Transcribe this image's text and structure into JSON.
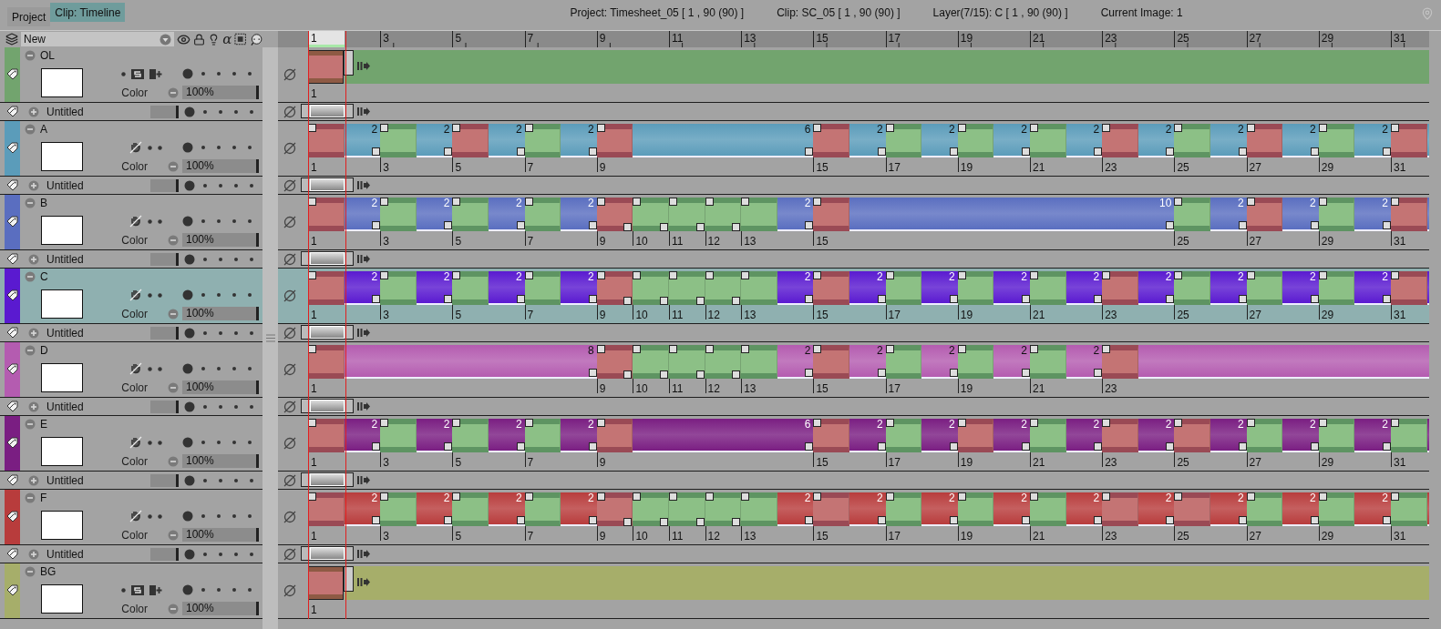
{
  "tabs": [
    {
      "label": "Project",
      "selected": false
    },
    {
      "label": "Clip: Timeline",
      "selected": true
    }
  ],
  "info": [
    "Project: Timesheet_05 [ 1 , 90  (90) ]",
    "Clip: SC_05 [ 1 , 90  (90) ]",
    "Layer(7/15): C [ 1 , 90  (90) ]",
    "Current Image: 1"
  ],
  "header": {
    "new_layer": "New",
    "alpha": "α"
  },
  "ruler": [
    {
      "label": "1",
      "selected": true
    },
    {
      "label": "3",
      "selected": false
    },
    {
      "label": "5",
      "selected": false
    },
    {
      "label": "7",
      "selected": false
    },
    {
      "label": "9",
      "selected": false
    },
    {
      "label": "11",
      "selected": false
    },
    {
      "label": "13",
      "selected": false
    },
    {
      "label": "15",
      "selected": false
    },
    {
      "label": "17",
      "selected": false
    },
    {
      "label": "19",
      "selected": false
    },
    {
      "label": "21",
      "selected": false
    },
    {
      "label": "23",
      "selected": false
    },
    {
      "label": "25",
      "selected": false
    },
    {
      "label": "27",
      "selected": false
    },
    {
      "label": "29",
      "selected": false
    },
    {
      "label": "31",
      "selected": false
    }
  ],
  "layers": [
    {
      "kind": "still",
      "name": "OL",
      "color": "#72a46e",
      "selected": false,
      "color_label": "Color",
      "opacity": "100%",
      "exposures": [
        {
          "frame": "1",
          "kind": "key",
          "open": true
        }
      ]
    },
    {
      "kind": "empty",
      "name": "Untitled",
      "level": 1
    },
    {
      "kind": "animation",
      "name": "A",
      "color": "#5b9cba",
      "selected": false,
      "color_label": "Color",
      "opacity": "100%",
      "exposures": [
        {
          "frame": "1",
          "kind": "key",
          "hold": "2"
        },
        {
          "frame": "3",
          "kind": "inbetween",
          "hold": "2"
        },
        {
          "frame": "5",
          "kind": "key",
          "hold": "2"
        },
        {
          "frame": "7",
          "kind": "inbetween",
          "hold": "2"
        },
        {
          "frame": "9",
          "kind": "key",
          "hold": "6"
        },
        {
          "frame": "15",
          "kind": "key",
          "hold": "2"
        },
        {
          "frame": "17",
          "kind": "inbetween",
          "hold": "2"
        },
        {
          "frame": "19",
          "kind": "inbetween",
          "hold": "2"
        },
        {
          "frame": "21",
          "kind": "inbetween",
          "hold": "2"
        },
        {
          "frame": "23",
          "kind": "key",
          "hold": "2"
        },
        {
          "frame": "25",
          "kind": "inbetween",
          "hold": "2"
        },
        {
          "frame": "27",
          "kind": "key",
          "hold": "2"
        },
        {
          "frame": "29",
          "kind": "inbetween",
          "hold": "2"
        },
        {
          "frame": "31",
          "kind": "key",
          "open": true
        }
      ]
    },
    {
      "kind": "empty",
      "name": "Untitled",
      "level": 1
    },
    {
      "kind": "animation",
      "name": "B",
      "color": "#5a6ec0",
      "selected": false,
      "color_label": "Color",
      "opacity": "100%",
      "exposures": [
        {
          "frame": "1",
          "kind": "key",
          "hold": "2"
        },
        {
          "frame": "3",
          "kind": "inbetween",
          "hold": "2"
        },
        {
          "frame": "5",
          "kind": "inbetween",
          "hold": "2"
        },
        {
          "frame": "7",
          "kind": "inbetween",
          "hold": "2"
        },
        {
          "frame": "9",
          "kind": "key"
        },
        {
          "frame": "10",
          "kind": "inbetween"
        },
        {
          "frame": "11",
          "kind": "inbetween"
        },
        {
          "frame": "12",
          "kind": "inbetween"
        },
        {
          "frame": "13",
          "kind": "inbetween",
          "hold": "2"
        },
        {
          "frame": "15",
          "kind": "key",
          "hold": "10"
        },
        {
          "frame": "25",
          "kind": "inbetween",
          "hold": "2"
        },
        {
          "frame": "27",
          "kind": "key",
          "hold": "2"
        },
        {
          "frame": "29",
          "kind": "inbetween",
          "hold": "2"
        },
        {
          "frame": "31",
          "kind": "key",
          "open": true
        }
      ]
    },
    {
      "kind": "empty",
      "name": "Untitled",
      "level": 1
    },
    {
      "kind": "animation",
      "name": "C",
      "color": "#5a1ad0",
      "selected": true,
      "color_label": "Color",
      "opacity": "100%",
      "exposures": [
        {
          "frame": "1",
          "kind": "key",
          "hold": "2"
        },
        {
          "frame": "3",
          "kind": "inbetween",
          "hold": "2"
        },
        {
          "frame": "5",
          "kind": "inbetween",
          "hold": "2"
        },
        {
          "frame": "7",
          "kind": "inbetween",
          "hold": "2"
        },
        {
          "frame": "9",
          "kind": "key"
        },
        {
          "frame": "10",
          "kind": "inbetween"
        },
        {
          "frame": "11",
          "kind": "inbetween"
        },
        {
          "frame": "12",
          "kind": "inbetween"
        },
        {
          "frame": "13",
          "kind": "inbetween",
          "hold": "2"
        },
        {
          "frame": "15",
          "kind": "key",
          "hold": "2"
        },
        {
          "frame": "17",
          "kind": "inbetween",
          "hold": "2"
        },
        {
          "frame": "19",
          "kind": "inbetween",
          "hold": "2"
        },
        {
          "frame": "21",
          "kind": "inbetween",
          "hold": "2"
        },
        {
          "frame": "23",
          "kind": "key",
          "hold": "2"
        },
        {
          "frame": "25",
          "kind": "inbetween",
          "hold": "2"
        },
        {
          "frame": "27",
          "kind": "inbetween",
          "hold": "2"
        },
        {
          "frame": "29",
          "kind": "inbetween",
          "hold": "2"
        },
        {
          "frame": "31",
          "kind": "key",
          "open": true
        }
      ]
    },
    {
      "kind": "empty",
      "name": "Untitled",
      "level": 1
    },
    {
      "kind": "animation",
      "name": "D",
      "color": "#b45cb0",
      "selected": false,
      "color_label": "Color",
      "opacity": "100%",
      "exposures": [
        {
          "frame": "1",
          "kind": "key",
          "hold": "8"
        },
        {
          "frame": "9",
          "kind": "key"
        },
        {
          "frame": "10",
          "kind": "inbetween"
        },
        {
          "frame": "11",
          "kind": "inbetween"
        },
        {
          "frame": "12",
          "kind": "inbetween"
        },
        {
          "frame": "13",
          "kind": "inbetween",
          "hold": "2"
        },
        {
          "frame": "15",
          "kind": "key",
          "hold": "2"
        },
        {
          "frame": "17",
          "kind": "inbetween",
          "hold": "2"
        },
        {
          "frame": "19",
          "kind": "inbetween",
          "hold": "2"
        },
        {
          "frame": "21",
          "kind": "inbetween",
          "hold": "2"
        },
        {
          "frame": "23",
          "kind": "key",
          "open": true
        }
      ]
    },
    {
      "kind": "empty",
      "name": "Untitled",
      "level": 1
    },
    {
      "kind": "animation",
      "name": "E",
      "color": "#7a1e82",
      "selected": false,
      "color_label": "Color",
      "opacity": "100%",
      "exposures": [
        {
          "frame": "1",
          "kind": "key",
          "hold": "2"
        },
        {
          "frame": "3",
          "kind": "inbetween",
          "hold": "2"
        },
        {
          "frame": "5",
          "kind": "inbetween",
          "hold": "2"
        },
        {
          "frame": "7",
          "kind": "inbetween",
          "hold": "2"
        },
        {
          "frame": "9",
          "kind": "key",
          "hold": "6"
        },
        {
          "frame": "15",
          "kind": "key",
          "hold": "2"
        },
        {
          "frame": "17",
          "kind": "inbetween",
          "hold": "2"
        },
        {
          "frame": "19",
          "kind": "key",
          "hold": "2"
        },
        {
          "frame": "21",
          "kind": "inbetween",
          "hold": "2"
        },
        {
          "frame": "23",
          "kind": "key",
          "hold": "2"
        },
        {
          "frame": "25",
          "kind": "key",
          "hold": "2"
        },
        {
          "frame": "27",
          "kind": "inbetween",
          "hold": "2"
        },
        {
          "frame": "29",
          "kind": "inbetween",
          "hold": "2"
        },
        {
          "frame": "31",
          "kind": "inbetween",
          "open": true
        }
      ]
    },
    {
      "kind": "empty",
      "name": "Untitled",
      "level": 1
    },
    {
      "kind": "animation",
      "name": "F",
      "color": "#b83c3c",
      "selected": false,
      "color_label": "Color",
      "opacity": "100%",
      "exposures": [
        {
          "frame": "1",
          "kind": "key",
          "hold": "2"
        },
        {
          "frame": "3",
          "kind": "inbetween",
          "hold": "2"
        },
        {
          "frame": "5",
          "kind": "inbetween",
          "hold": "2"
        },
        {
          "frame": "7",
          "kind": "inbetween",
          "hold": "2"
        },
        {
          "frame": "9",
          "kind": "key"
        },
        {
          "frame": "10",
          "kind": "inbetween"
        },
        {
          "frame": "11",
          "kind": "inbetween"
        },
        {
          "frame": "12",
          "kind": "inbetween"
        },
        {
          "frame": "13",
          "kind": "inbetween",
          "hold": "2"
        },
        {
          "frame": "15",
          "kind": "key",
          "hold": "2"
        },
        {
          "frame": "17",
          "kind": "inbetween",
          "hold": "2"
        },
        {
          "frame": "19",
          "kind": "inbetween",
          "hold": "2"
        },
        {
          "frame": "21",
          "kind": "inbetween",
          "hold": "2"
        },
        {
          "frame": "23",
          "kind": "key",
          "hold": "2"
        },
        {
          "frame": "25",
          "kind": "key",
          "hold": "2"
        },
        {
          "frame": "27",
          "kind": "inbetween",
          "hold": "2"
        },
        {
          "frame": "29",
          "kind": "inbetween",
          "hold": "2"
        },
        {
          "frame": "31",
          "kind": "inbetween",
          "open": true
        }
      ]
    },
    {
      "kind": "empty",
      "name": "Untitled",
      "level": 1
    },
    {
      "kind": "still",
      "name": "BG",
      "color": "#a6ae6a",
      "selected": false,
      "color_label": "Color",
      "opacity": "100%",
      "exposures": [
        {
          "frame": "1",
          "kind": "key",
          "open": true
        }
      ]
    }
  ]
}
